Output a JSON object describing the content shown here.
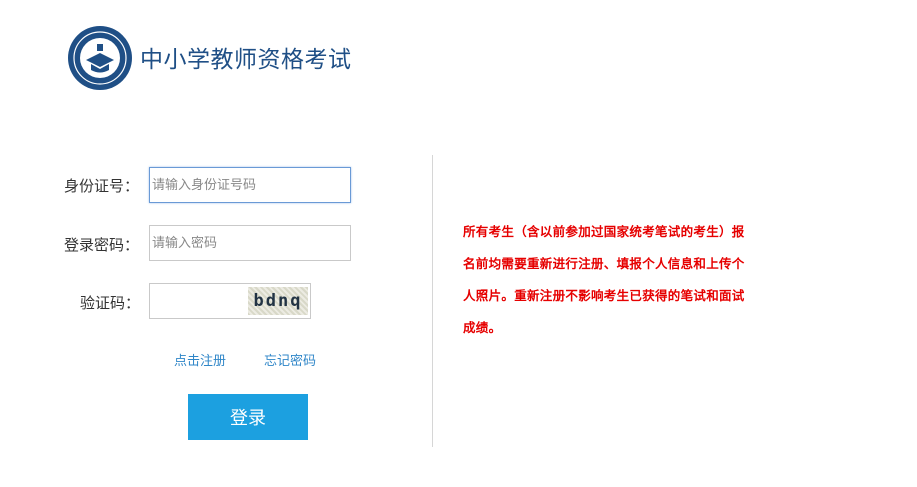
{
  "header": {
    "title": "中小学教师资格考试"
  },
  "form": {
    "id_label": "身份证号：",
    "id_placeholder": "请输入身份证号码",
    "password_label": "登录密码：",
    "password_placeholder": "请输入密码",
    "captcha_label": "验证码：",
    "captcha_text": "bdnq"
  },
  "links": {
    "register": "点击注册",
    "forgot_password": "忘记密码"
  },
  "actions": {
    "login": "登录"
  },
  "notice": {
    "text": "所有考生（含以前参加过国家统考笔试的考生）报名前均需要重新进行注册、填报个人信息和上传个人照片。重新注册不影响考生已获得的笔试和面试成绩。"
  },
  "colors": {
    "brand": "#1f4f86",
    "button": "#1ca0e0",
    "link": "#2f86c8",
    "notice": "#e60000"
  }
}
